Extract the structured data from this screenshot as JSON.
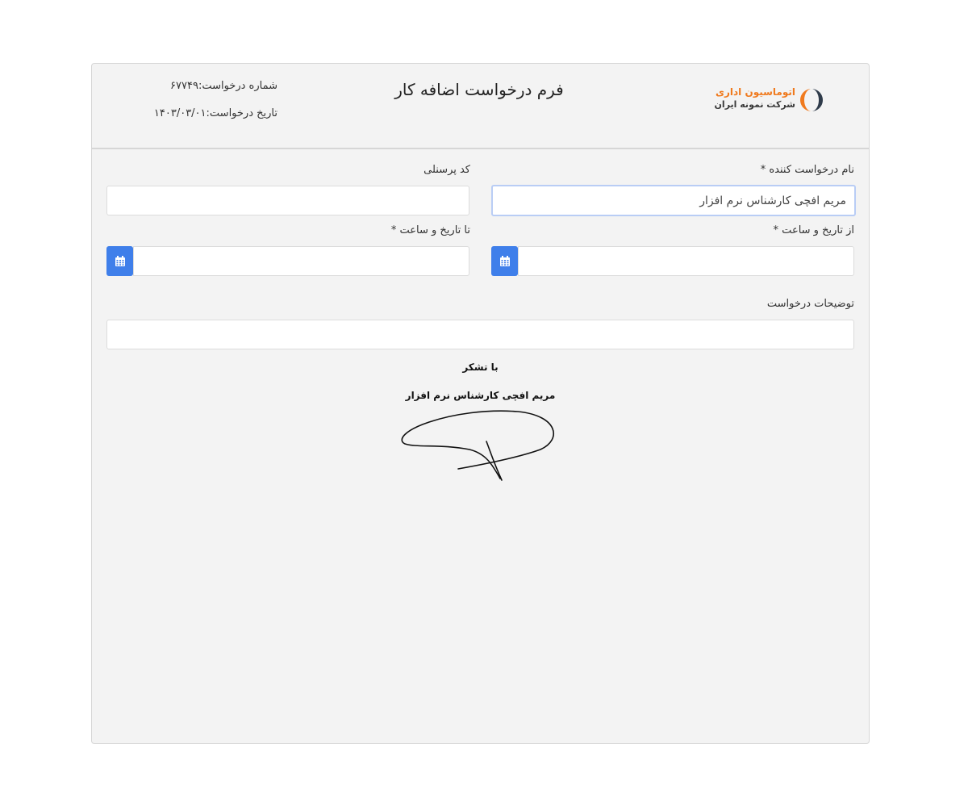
{
  "logo": {
    "line1": "اتوماسیون اداری",
    "line2": "شرکت نمونه ایران",
    "icon": "logo-ring-icon",
    "accent_color": "#f07a1e"
  },
  "header": {
    "title": "فرم درخواست اضافه کار",
    "request_number": "شماره درخواست:۶۷۷۴۹",
    "request_date": "تاریخ درخواست:۱۴۰۳/۰۳/۰۱"
  },
  "form": {
    "requester_label": "نام درخواست کننده *",
    "requester_value": "مریم افچی کارشناس نرم افزار",
    "personnel_label": "کد پرسنلی",
    "personnel_value": "",
    "from_label": "از تاریخ و ساعت *",
    "from_value": "",
    "to_label": "تا تاریخ و ساعت *",
    "to_value": "",
    "description_label": "توضیحات درخواست",
    "description_value": "",
    "calendar_icon": "calendar-icon",
    "button_color": "#3f7fea"
  },
  "footer": {
    "thanks": "با تشکر",
    "signer_name": "مریم افچی کارشناس نرم افزار"
  }
}
